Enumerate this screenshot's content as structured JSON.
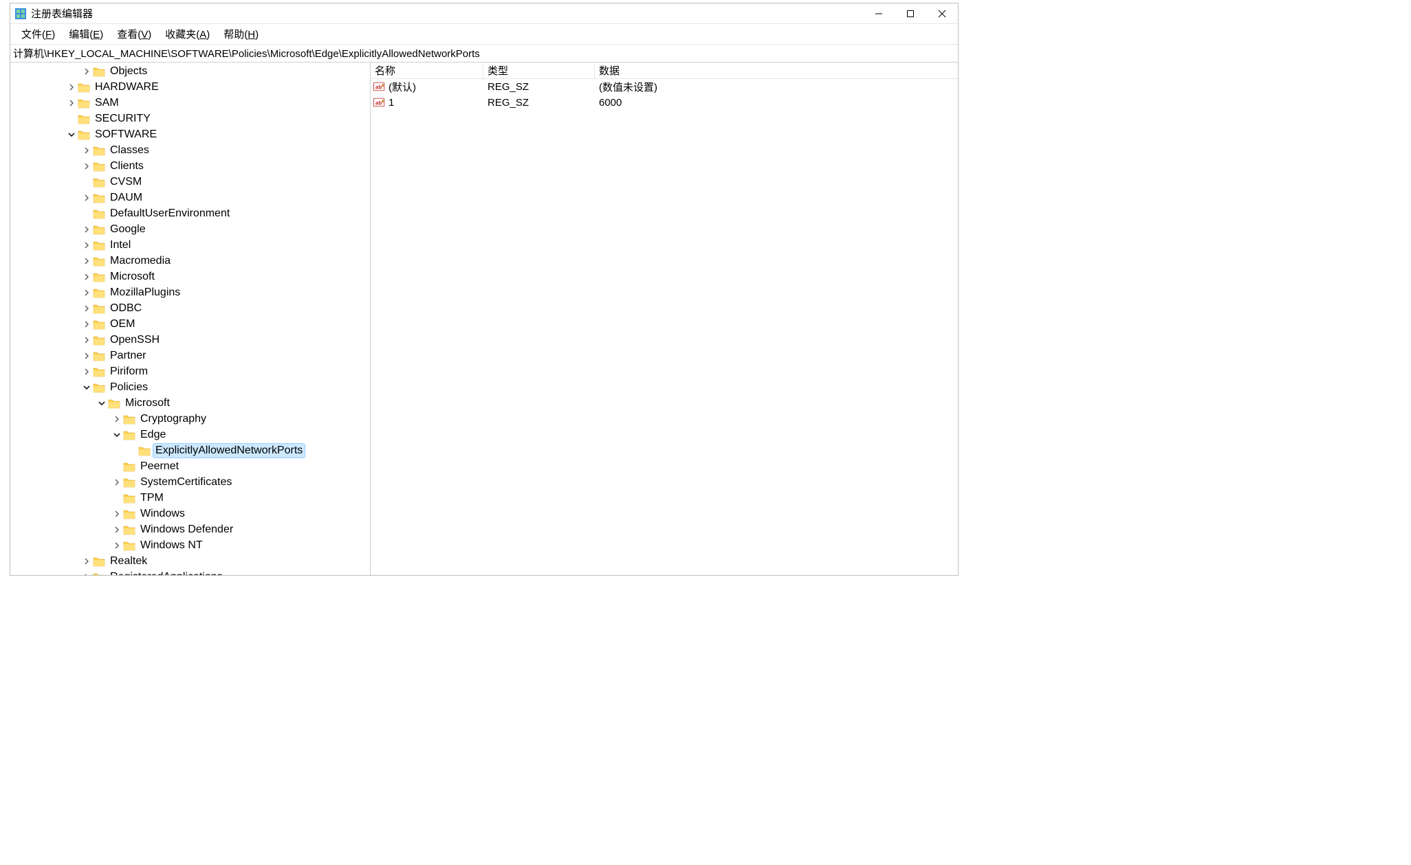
{
  "window": {
    "title": "注册表编辑器"
  },
  "menus": {
    "file": {
      "label": "文件",
      "accel": "F"
    },
    "edit": {
      "label": "编辑",
      "accel": "E"
    },
    "view": {
      "label": "查看",
      "accel": "V"
    },
    "fav": {
      "label": "收藏夹",
      "accel": "A"
    },
    "help": {
      "label": "帮助",
      "accel": "H"
    }
  },
  "address": {
    "path": "计算机\\HKEY_LOCAL_MACHINE\\SOFTWARE\\Policies\\Microsoft\\Edge\\ExplicitlyAllowedNetworkPorts"
  },
  "tree": [
    {
      "indent": 3,
      "expander": "right",
      "label": "Objects"
    },
    {
      "indent": 2,
      "expander": "right",
      "label": "HARDWARE"
    },
    {
      "indent": 2,
      "expander": "right",
      "label": "SAM"
    },
    {
      "indent": 2,
      "expander": "none",
      "label": "SECURITY"
    },
    {
      "indent": 2,
      "expander": "down",
      "label": "SOFTWARE"
    },
    {
      "indent": 3,
      "expander": "right",
      "label": "Classes"
    },
    {
      "indent": 3,
      "expander": "right",
      "label": "Clients"
    },
    {
      "indent": 3,
      "expander": "none",
      "label": "CVSM"
    },
    {
      "indent": 3,
      "expander": "right",
      "label": "DAUM"
    },
    {
      "indent": 3,
      "expander": "none",
      "label": "DefaultUserEnvironment"
    },
    {
      "indent": 3,
      "expander": "right",
      "label": "Google"
    },
    {
      "indent": 3,
      "expander": "right",
      "label": "Intel"
    },
    {
      "indent": 3,
      "expander": "right",
      "label": "Macromedia"
    },
    {
      "indent": 3,
      "expander": "right",
      "label": "Microsoft"
    },
    {
      "indent": 3,
      "expander": "right",
      "label": "MozillaPlugins"
    },
    {
      "indent": 3,
      "expander": "right",
      "label": "ODBC"
    },
    {
      "indent": 3,
      "expander": "right",
      "label": "OEM"
    },
    {
      "indent": 3,
      "expander": "right",
      "label": "OpenSSH"
    },
    {
      "indent": 3,
      "expander": "right",
      "label": "Partner"
    },
    {
      "indent": 3,
      "expander": "right",
      "label": "Piriform"
    },
    {
      "indent": 3,
      "expander": "down",
      "label": "Policies"
    },
    {
      "indent": 4,
      "expander": "down",
      "label": "Microsoft"
    },
    {
      "indent": 5,
      "expander": "right",
      "label": "Cryptography"
    },
    {
      "indent": 5,
      "expander": "down",
      "label": "Edge"
    },
    {
      "indent": 6,
      "expander": "none",
      "label": "ExplicitlyAllowedNetworkPorts",
      "selected": true
    },
    {
      "indent": 5,
      "expander": "none",
      "label": "Peernet"
    },
    {
      "indent": 5,
      "expander": "right",
      "label": "SystemCertificates"
    },
    {
      "indent": 5,
      "expander": "none",
      "label": "TPM"
    },
    {
      "indent": 5,
      "expander": "right",
      "label": "Windows"
    },
    {
      "indent": 5,
      "expander": "right",
      "label": "Windows Defender"
    },
    {
      "indent": 5,
      "expander": "right",
      "label": "Windows NT"
    },
    {
      "indent": 3,
      "expander": "right",
      "label": "Realtek"
    },
    {
      "indent": 3,
      "expander": "right",
      "label": "RegisteredApplications"
    }
  ],
  "list": {
    "columns": {
      "name": "名称",
      "type": "类型",
      "data": "数据"
    },
    "rows": [
      {
        "name": "(默认)",
        "type": "REG_SZ",
        "data": "(数值未设置)"
      },
      {
        "name": "1",
        "type": "REG_SZ",
        "data": "6000"
      }
    ]
  }
}
